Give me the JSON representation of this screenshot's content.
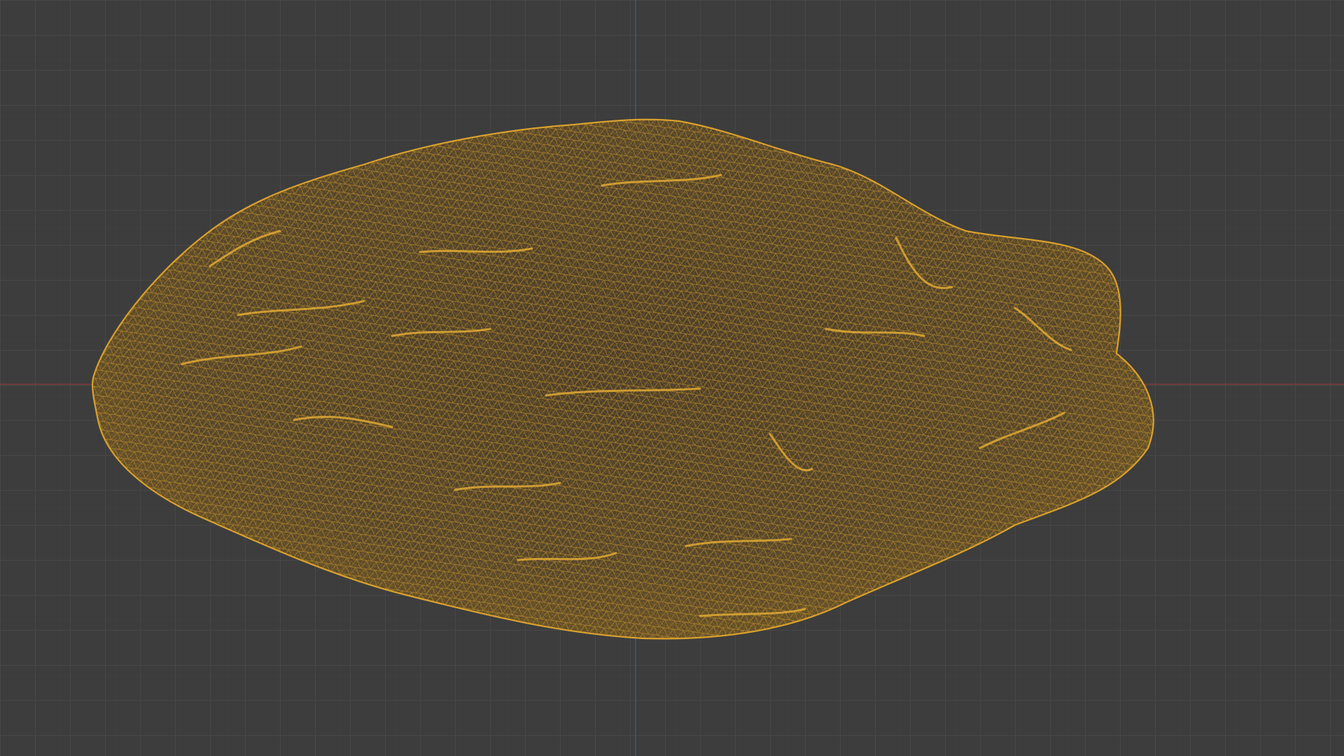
{
  "viewport": {
    "background_color": "#3d3d3d",
    "grid_color": "#484848",
    "x_axis_color": "#8a3a3a",
    "y_axis_color": "#3b5f8f",
    "object": {
      "display_mode": "wireframe",
      "wire_color": "#d4a02a",
      "fill_color": "#5a4a30"
    }
  }
}
